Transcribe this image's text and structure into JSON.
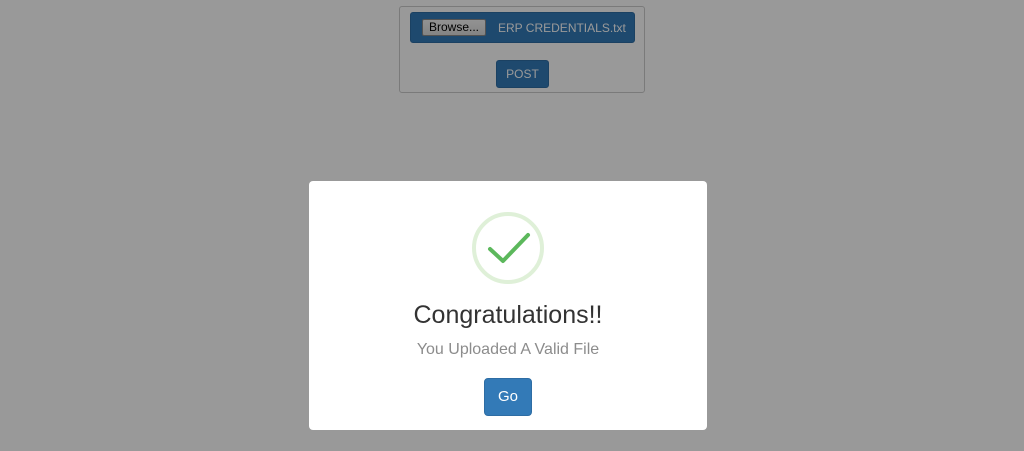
{
  "upload_form": {
    "browse_label": "Browse...",
    "file_name": "ERP CREDENTIALS.txt",
    "post_label": "POST"
  },
  "modal": {
    "icon": "checkmark-icon",
    "title": "Congratulations!!",
    "message": "You Uploaded A Valid File",
    "go_label": "Go"
  },
  "colors": {
    "primary": "#337ab7",
    "success": "#5cb85c",
    "overlay": "rgba(0,0,0,0.4)"
  }
}
